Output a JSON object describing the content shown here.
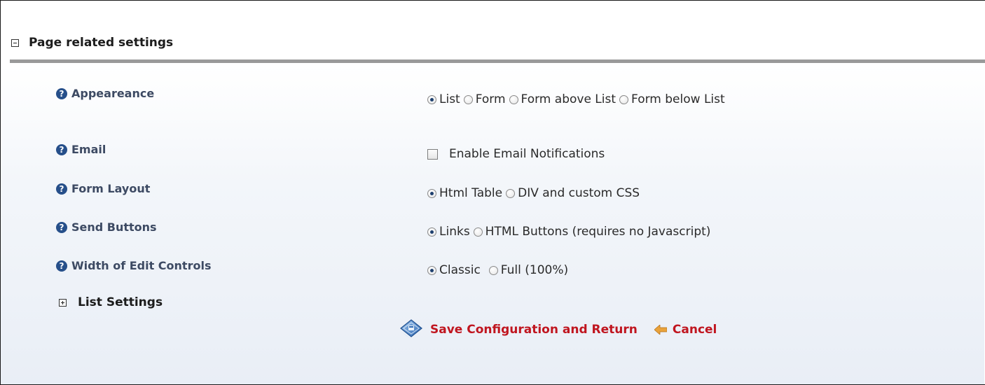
{
  "section": {
    "title": "Page related settings",
    "toggle_icon": "collapse-minus-icon"
  },
  "settings": {
    "appearance": {
      "label": "Appeareance",
      "options": [
        "List",
        "Form",
        "Form above List",
        "Form below List"
      ],
      "selected": "List"
    },
    "email": {
      "label": "Email",
      "checkbox_label": "Enable Email Notifications",
      "checked": false
    },
    "form_layout": {
      "label": "Form Layout",
      "options": [
        "Html Table",
        "DIV and custom CSS"
      ],
      "selected": "Html Table"
    },
    "send_buttons": {
      "label": "Send Buttons",
      "options": [
        "Links",
        "HTML Buttons (requires no Javascript)"
      ],
      "selected": "Links"
    },
    "edit_width": {
      "label": "Width of Edit Controls",
      "options": [
        "Classic",
        "Full (100%)"
      ],
      "selected": "Classic"
    }
  },
  "list_settings": {
    "title": "List Settings",
    "toggle_icon": "expand-plus-icon"
  },
  "actions": {
    "save_label": "Save Configuration and Return",
    "cancel_label": "Cancel"
  },
  "help_icon_glyph": "?",
  "colors": {
    "label": "#3d4a63",
    "action": "#c0151f",
    "help_icon": "#264f8a"
  }
}
